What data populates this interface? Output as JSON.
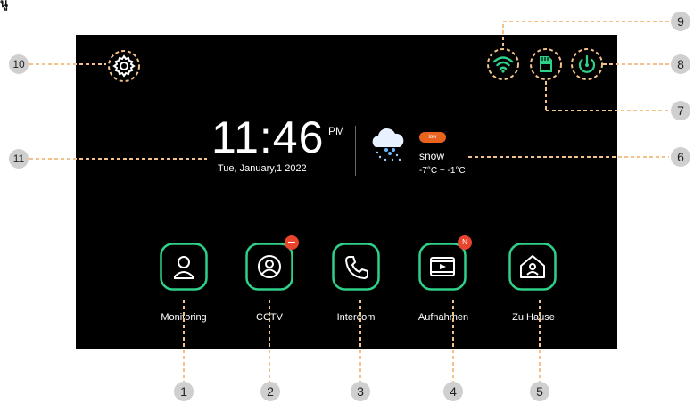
{
  "heading": "นู้",
  "clock": {
    "time": "11:46",
    "ampm": "PM",
    "date": "Tue, January,1 2022"
  },
  "weather": {
    "badge": "low",
    "condition": "snow",
    "range": "-7°C ~ -1°C"
  },
  "status_icons": [
    "wifi-icon",
    "sd-card-icon",
    "power-icon"
  ],
  "tiles": [
    {
      "label": "Monitoring",
      "icon": "person-icon"
    },
    {
      "label": "CCTV",
      "icon": "camera-person-icon",
      "badge": "minus"
    },
    {
      "label": "Intercom",
      "icon": "phone-icon"
    },
    {
      "label": "Aufnahmen",
      "icon": "video-icon",
      "badge": "N"
    },
    {
      "label": "Zu Hause",
      "icon": "home-icon"
    }
  ],
  "callouts": [
    "1",
    "2",
    "3",
    "4",
    "5",
    "6",
    "7",
    "8",
    "9",
    "10",
    "11"
  ],
  "colors": {
    "accent": "#2fd08a",
    "highlight": "#f2c28a",
    "alert": "#e8452c",
    "badge": "#e8641e"
  }
}
